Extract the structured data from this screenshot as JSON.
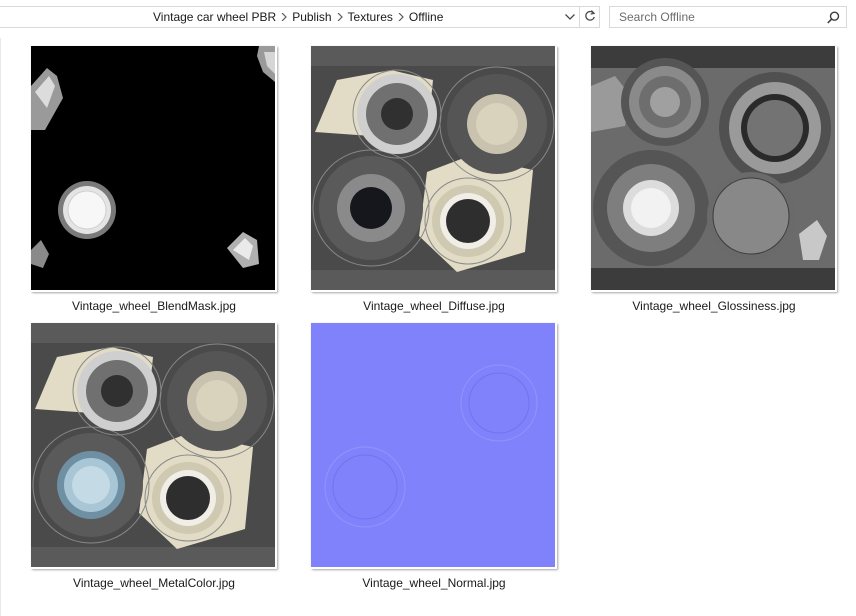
{
  "address_bar": {
    "breadcrumbs": [
      {
        "label": "Vintage car wheel PBR"
      },
      {
        "label": "Publish"
      },
      {
        "label": "Textures"
      },
      {
        "label": "Offline"
      }
    ],
    "dropdown_icon": "chevron-down-icon",
    "refresh_icon": "refresh-icon"
  },
  "search": {
    "placeholder": "Search Offline",
    "value": "",
    "icon": "search-icon"
  },
  "files": [
    {
      "name": "Vintage_wheel_BlendMask.jpg",
      "kind": "blendmask"
    },
    {
      "name": "Vintage_wheel_Diffuse.jpg",
      "kind": "diffuse"
    },
    {
      "name": "Vintage_wheel_Glossiness.jpg",
      "kind": "gloss"
    },
    {
      "name": "Vintage_wheel_MetalColor.jpg",
      "kind": "metal"
    },
    {
      "name": "Vintage_wheel_Normal.jpg",
      "kind": "normal"
    }
  ],
  "colors": {
    "border": "#d9d9d9",
    "normal_map": "#7f82fb",
    "diffuse_bg": "#4a4a4a",
    "cream": "#e2dcc6"
  }
}
